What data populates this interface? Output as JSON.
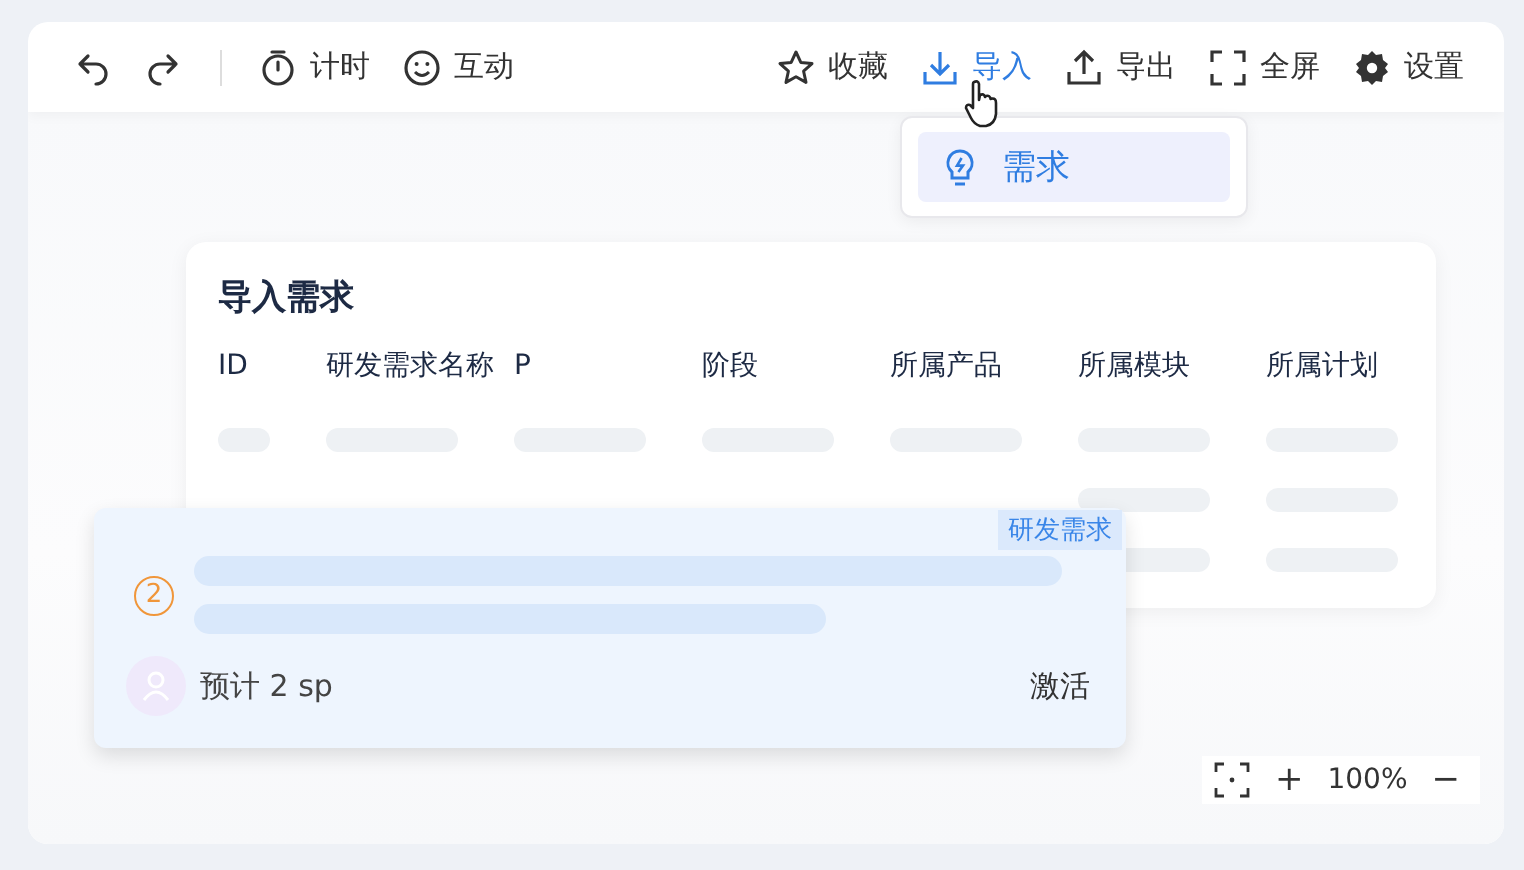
{
  "toolbar": {
    "left": [
      {
        "kind": "undo"
      },
      {
        "kind": "redo"
      },
      {
        "kind": "timer",
        "label": "计时"
      },
      {
        "kind": "smile",
        "label": "互动"
      }
    ],
    "right": [
      {
        "kind": "star",
        "label": "收藏",
        "selected": false
      },
      {
        "kind": "import",
        "label": "导入",
        "selected": true
      },
      {
        "kind": "export",
        "label": "导出",
        "selected": false
      },
      {
        "kind": "fullscreen",
        "label": "全屏",
        "selected": false
      },
      {
        "kind": "settings",
        "label": "设置",
        "selected": false
      }
    ]
  },
  "dropdown": {
    "items": [
      {
        "label": "需求",
        "selected": true
      }
    ]
  },
  "import_panel": {
    "title": "导入需求",
    "columns": [
      "ID",
      "研发需求名称",
      "P",
      "阶段",
      "所属产品",
      "所属模块",
      "所属计划"
    ]
  },
  "card": {
    "tag": "研发需求",
    "number": "2",
    "estimate": "预计 2 sp",
    "status": "激活"
  },
  "zoom": {
    "plus": "+",
    "value": "100%",
    "minus": "−"
  }
}
